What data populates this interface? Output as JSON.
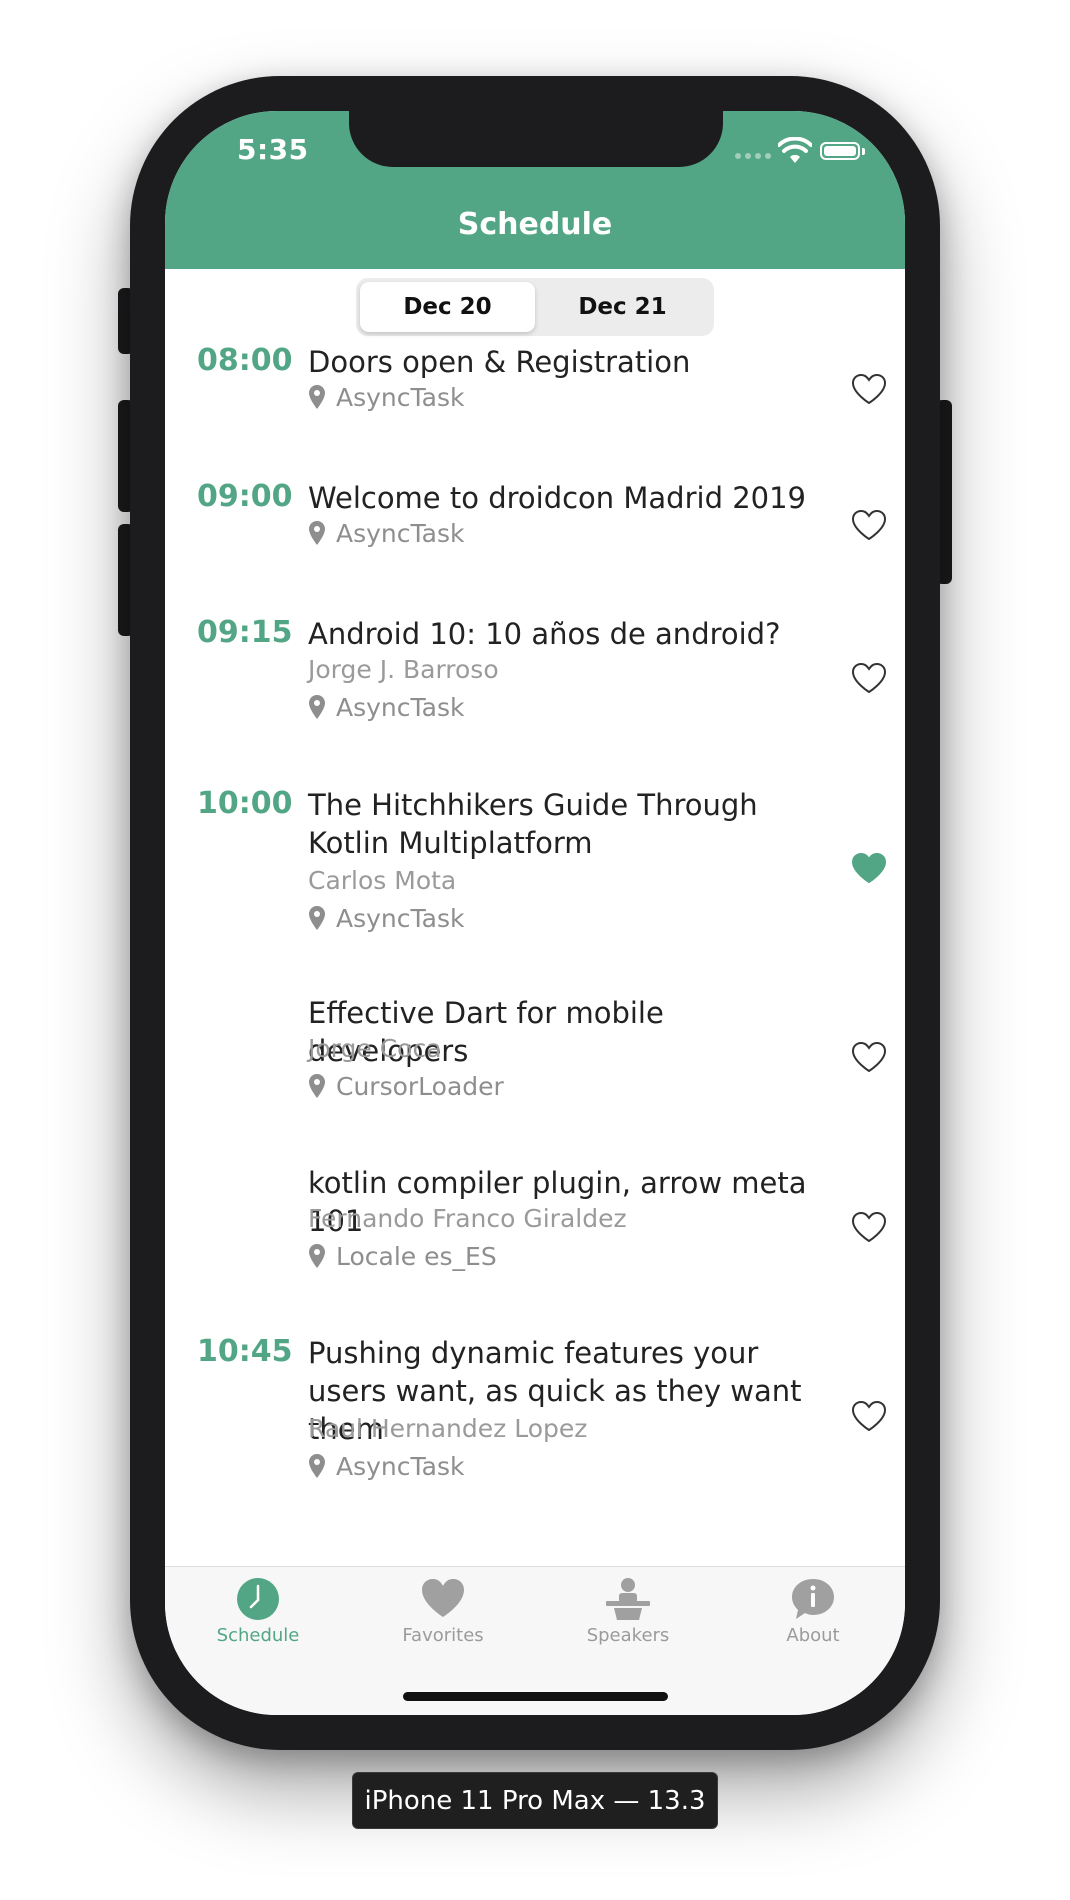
{
  "status_bar": {
    "time": "5:35"
  },
  "nav": {
    "title": "Schedule"
  },
  "date_tabs": [
    {
      "label": "Dec 20",
      "selected": true
    },
    {
      "label": "Dec 21",
      "selected": false
    }
  ],
  "sessions": [
    {
      "time": "08:00",
      "title": "Doors open & Registration",
      "speaker": "",
      "room": "AsyncTask",
      "favorite": false
    },
    {
      "time": "09:00",
      "title": "Welcome to droidcon Madrid 2019",
      "speaker": "",
      "room": "AsyncTask",
      "favorite": false
    },
    {
      "time": "09:15",
      "title": "Android 10: 10 años de android?",
      "speaker": "Jorge J. Barroso",
      "room": "AsyncTask",
      "favorite": false
    },
    {
      "time": "10:00",
      "title": "The Hitchhikers Guide Through Kotlin Multiplatform",
      "speaker": "Carlos Mota",
      "room": "AsyncTask",
      "favorite": true
    },
    {
      "time": "",
      "title": "Effective Dart for mobile developers",
      "speaker": "Jorge Coca",
      "room": "CursorLoader",
      "favorite": false
    },
    {
      "time": "",
      "title": "kotlin compiler plugin, arrow meta 101",
      "speaker": "Fernando Franco Giraldez",
      "room": "Locale es_ES",
      "favorite": false
    },
    {
      "time": "10:45",
      "title": "Pushing dynamic features your users want, as quick as they want them",
      "speaker": "Raul Hernandez Lopez",
      "room": "AsyncTask",
      "favorite": false
    }
  ],
  "tabbar": {
    "items": [
      {
        "label": "Schedule",
        "icon": "clock-icon",
        "active": true
      },
      {
        "label": "Favorites",
        "icon": "heart-icon",
        "active": false
      },
      {
        "label": "Speakers",
        "icon": "podium-icon",
        "active": false
      },
      {
        "label": "About",
        "icon": "info-bubble-icon",
        "active": false
      }
    ]
  },
  "device_label": "iPhone 11 Pro Max — 13.3",
  "colors": {
    "accent": "#53a685",
    "favorite": "#53a685"
  }
}
